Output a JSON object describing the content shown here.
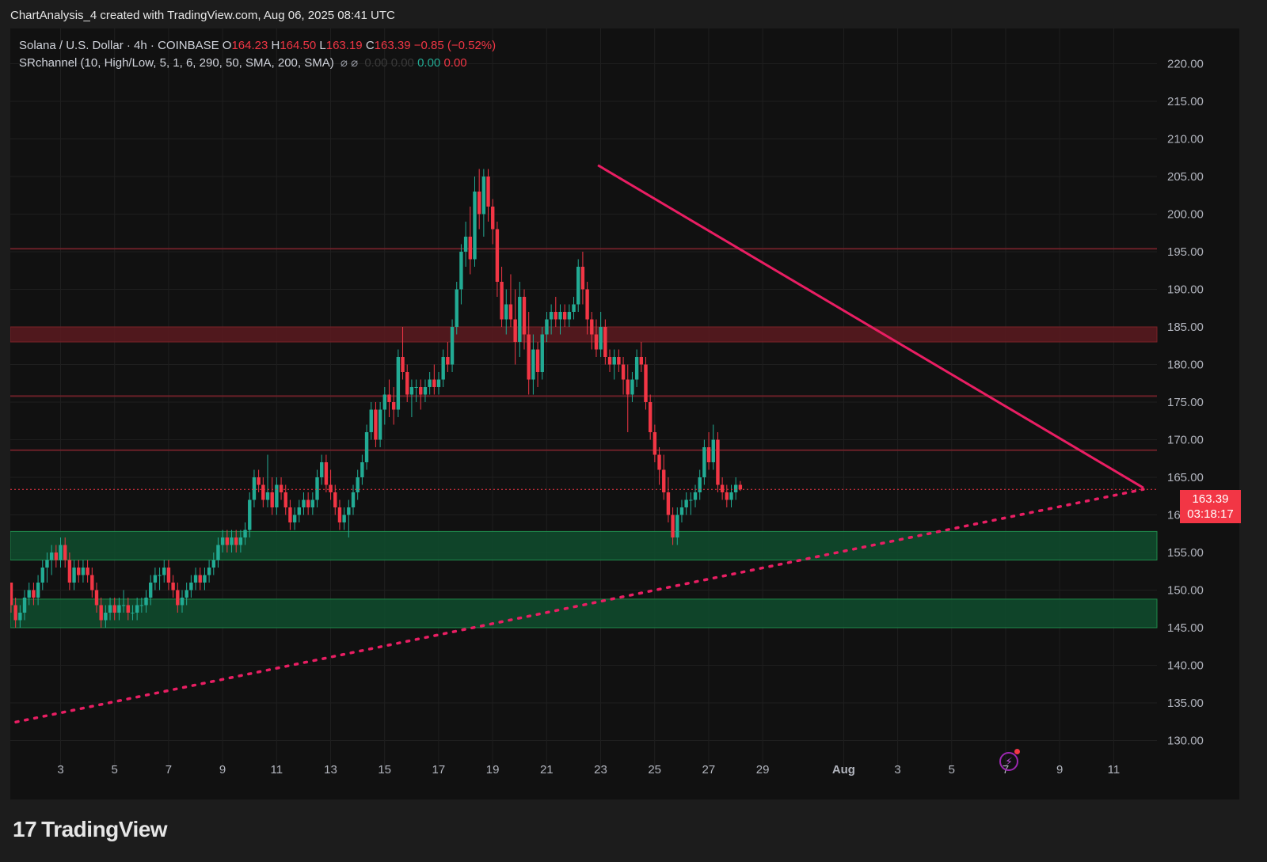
{
  "header": {
    "caption": "ChartAnalysis_4 created with TradingView.com, Aug 06, 2025 08:41 UTC"
  },
  "legend": {
    "symbol": "Solana / U.S. Dollar · 4h · COINBASE",
    "o_label": "O",
    "o_value": "164.23",
    "h_label": "H",
    "h_value": "164.50",
    "l_label": "L",
    "l_value": "163.19",
    "c_label": "C",
    "c_value": "163.39",
    "change": "−0.85 (−0.52%)",
    "indicator": "SRchannel (10, High/Low, 5, 1, 6, 290, 50, SMA, 200, SMA)",
    "indicator_symbols": "⌀ ⌀",
    "ind_v1": "0.00",
    "ind_v2": "0.00",
    "ind_v3": "0.00",
    "ind_v4": "0.00"
  },
  "price_tag": {
    "price": "163.39",
    "countdown": "03:18:17"
  },
  "brand": {
    "logo": "17",
    "name": "TradingView"
  },
  "colors": {
    "background": "#111111",
    "up": "#22ab94",
    "down": "#f23645",
    "trendline": "#e91e63",
    "resistance_zone": "#5c1a20",
    "support_zone": "#0f4a2c",
    "price_tag": "#f23645"
  },
  "chart_data": {
    "type": "candlestick",
    "title": "Solana / U.S. Dollar · 4h · COINBASE",
    "y_axis": {
      "position": "right",
      "ylim": [
        127.5,
        223.5
      ],
      "ticks": [
        "220.00",
        "215.00",
        "210.00",
        "205.00",
        "200.00",
        "195.00",
        "190.00",
        "185.00",
        "180.00",
        "175.00",
        "170.00",
        "165.00",
        "160.00",
        "155.00",
        "150.00",
        "145.00",
        "140.00",
        "135.00",
        "130.00"
      ],
      "tick_values": [
        220,
        215,
        210,
        205,
        200,
        195,
        190,
        185,
        180,
        175,
        170,
        165,
        160,
        155,
        150,
        145,
        140,
        135,
        130
      ]
    },
    "x_axis": {
      "ticks": [
        {
          "label": "3",
          "day": 3
        },
        {
          "label": "5",
          "day": 5
        },
        {
          "label": "7",
          "day": 7
        },
        {
          "label": "9",
          "day": 9
        },
        {
          "label": "11",
          "day": 11
        },
        {
          "label": "13",
          "day": 13
        },
        {
          "label": "15",
          "day": 15
        },
        {
          "label": "17",
          "day": 17
        },
        {
          "label": "19",
          "day": 19
        },
        {
          "label": "21",
          "day": 21
        },
        {
          "label": "23",
          "day": 23
        },
        {
          "label": "25",
          "day": 25
        },
        {
          "label": "27",
          "day": 27
        },
        {
          "label": "29",
          "day": 29
        },
        {
          "label": "Aug",
          "day": 32
        },
        {
          "label": "3",
          "day": 34
        },
        {
          "label": "5",
          "day": 36
        },
        {
          "label": "7",
          "day": 38
        },
        {
          "label": "9",
          "day": 40
        },
        {
          "label": "11",
          "day": 42
        }
      ]
    },
    "grid": true,
    "zones": [
      {
        "kind": "resistance",
        "low": 183,
        "high": 185
      },
      {
        "kind": "support",
        "low": 154,
        "high": 157.8
      },
      {
        "kind": "support",
        "low": 145,
        "high": 148.8
      }
    ],
    "levels": [
      {
        "kind": "resistance",
        "value": 195.4
      },
      {
        "kind": "resistance",
        "value": 175.8
      },
      {
        "kind": "resistance",
        "value": 168.6
      }
    ],
    "trendlines": [
      {
        "kind": "descending",
        "style": "solid",
        "from": {
          "day": 22.9,
          "price": 206.5
        },
        "to": {
          "day": 43.1,
          "price": 163.6
        }
      },
      {
        "kind": "ascending",
        "style": "dotted",
        "from": {
          "day": 1.0,
          "price": 132.2
        },
        "to": {
          "day": 43.1,
          "price": 163.4
        }
      }
    ],
    "last_price": 163.39,
    "ohlc_step_days": 0.1667,
    "candles_start_day": 1.0,
    "candles": [
      [
        153,
        153,
        149,
        151
      ],
      [
        151,
        151,
        147,
        148
      ],
      [
        148,
        149,
        145,
        146
      ],
      [
        146,
        148,
        145,
        147
      ],
      [
        147,
        150,
        146,
        149
      ],
      [
        149,
        151,
        148,
        150
      ],
      [
        150,
        151,
        148,
        149
      ],
      [
        149,
        152,
        148,
        151
      ],
      [
        151,
        154,
        150,
        153
      ],
      [
        153,
        155,
        151,
        154
      ],
      [
        154,
        156,
        152,
        155
      ],
      [
        155,
        156,
        153,
        154
      ],
      [
        154,
        157,
        153,
        156
      ],
      [
        156,
        157,
        153,
        154
      ],
      [
        154,
        155,
        150,
        151
      ],
      [
        151,
        154,
        150,
        153
      ],
      [
        153,
        154,
        151,
        152
      ],
      [
        152,
        154,
        151,
        153
      ],
      [
        153,
        154,
        151,
        152
      ],
      [
        152,
        153,
        149,
        150
      ],
      [
        150,
        151,
        147,
        148
      ],
      [
        148,
        149,
        145,
        146
      ],
      [
        146,
        148,
        145,
        147
      ],
      [
        147,
        149,
        146,
        148
      ],
      [
        148,
        149,
        146,
        147
      ],
      [
        147,
        149,
        146,
        148
      ],
      [
        148,
        150,
        147,
        148
      ],
      [
        148,
        149,
        146,
        147
      ],
      [
        147,
        148,
        146,
        147
      ],
      [
        147,
        149,
        146,
        148
      ],
      [
        148,
        149,
        147,
        148
      ],
      [
        148,
        150,
        147,
        149
      ],
      [
        149,
        152,
        148,
        151
      ],
      [
        151,
        153,
        150,
        152
      ],
      [
        152,
        153,
        150,
        152
      ],
      [
        152,
        154,
        151,
        153
      ],
      [
        153,
        154,
        150,
        151
      ],
      [
        151,
        152,
        149,
        150
      ],
      [
        150,
        151,
        147,
        148
      ],
      [
        148,
        150,
        147,
        149
      ],
      [
        149,
        151,
        148,
        150
      ],
      [
        150,
        152,
        149,
        151
      ],
      [
        151,
        153,
        150,
        152
      ],
      [
        152,
        153,
        150,
        151
      ],
      [
        151,
        153,
        150,
        152
      ],
      [
        152,
        154,
        151,
        153
      ],
      [
        153,
        155,
        152,
        154
      ],
      [
        154,
        157,
        153,
        156
      ],
      [
        156,
        158,
        155,
        157
      ],
      [
        157,
        158,
        155,
        156
      ],
      [
        156,
        158,
        155,
        157
      ],
      [
        157,
        158,
        155,
        156
      ],
      [
        156,
        158,
        155,
        157
      ],
      [
        157,
        159,
        156,
        158
      ],
      [
        158,
        163,
        157,
        162
      ],
      [
        162,
        166,
        161,
        165
      ],
      [
        165,
        166,
        163,
        164
      ],
      [
        164,
        165,
        161,
        162
      ],
      [
        162,
        168,
        161,
        163
      ],
      [
        163,
        165,
        160,
        161
      ],
      [
        161,
        165,
        160,
        164
      ],
      [
        164,
        165,
        162,
        163
      ],
      [
        163,
        164,
        160,
        161
      ],
      [
        161,
        162,
        158,
        159
      ],
      [
        159,
        161,
        158,
        160
      ],
      [
        160,
        162,
        159,
        161
      ],
      [
        161,
        163,
        160,
        162
      ],
      [
        162,
        163,
        160,
        161
      ],
      [
        161,
        163,
        160,
        162
      ],
      [
        162,
        166,
        161,
        165
      ],
      [
        165,
        168,
        164,
        167
      ],
      [
        167,
        168,
        163,
        164
      ],
      [
        164,
        166,
        162,
        163
      ],
      [
        163,
        164,
        160,
        161
      ],
      [
        161,
        162,
        158,
        159
      ],
      [
        159,
        161,
        158,
        160
      ],
      [
        160,
        162,
        157,
        161
      ],
      [
        161,
        164,
        160,
        163
      ],
      [
        163,
        166,
        162,
        165
      ],
      [
        165,
        168,
        164,
        167
      ],
      [
        167,
        172,
        166,
        171
      ],
      [
        171,
        175,
        170,
        174
      ],
      [
        174,
        175,
        169,
        170
      ],
      [
        170,
        175,
        169,
        174
      ],
      [
        174,
        177,
        172,
        176
      ],
      [
        176,
        178,
        173,
        175
      ],
      [
        175,
        177,
        172,
        174
      ],
      [
        174,
        182,
        173,
        181
      ],
      [
        181,
        185,
        178,
        179
      ],
      [
        179,
        180,
        175,
        176
      ],
      [
        176,
        178,
        173,
        177
      ],
      [
        177,
        178,
        175,
        177
      ],
      [
        177,
        178,
        174,
        176
      ],
      [
        176,
        178,
        175,
        177
      ],
      [
        177,
        179,
        176,
        178
      ],
      [
        178,
        180,
        176,
        177
      ],
      [
        177,
        179,
        176,
        178
      ],
      [
        178,
        182,
        177,
        181
      ],
      [
        181,
        183,
        179,
        180
      ],
      [
        180,
        186,
        179,
        185
      ],
      [
        185,
        191,
        184,
        190
      ],
      [
        190,
        196,
        188,
        195
      ],
      [
        195,
        199,
        193,
        197
      ],
      [
        197,
        201,
        192,
        194
      ],
      [
        194,
        205,
        193,
        203
      ],
      [
        203,
        206,
        198,
        200
      ],
      [
        200,
        206,
        197,
        205
      ],
      [
        205,
        206,
        199,
        201
      ],
      [
        201,
        202,
        196,
        198
      ],
      [
        198,
        199,
        189,
        191
      ],
      [
        191,
        193,
        185,
        186
      ],
      [
        186,
        190,
        184,
        188
      ],
      [
        188,
        192,
        185,
        186
      ],
      [
        186,
        190,
        180,
        183
      ],
      [
        183,
        191,
        181,
        189
      ],
      [
        189,
        190,
        182,
        184
      ],
      [
        184,
        187,
        176,
        178
      ],
      [
        178,
        184,
        176,
        182
      ],
      [
        182,
        183,
        177,
        179
      ],
      [
        179,
        185,
        178,
        184
      ],
      [
        184,
        187,
        183,
        186
      ],
      [
        186,
        188,
        184,
        187
      ],
      [
        187,
        189,
        185,
        186
      ],
      [
        186,
        188,
        184,
        187
      ],
      [
        187,
        188,
        185,
        186
      ],
      [
        186,
        188,
        185,
        187
      ],
      [
        187,
        189,
        186,
        188
      ],
      [
        188,
        194,
        187,
        193
      ],
      [
        193,
        195,
        188,
        190
      ],
      [
        190,
        191,
        184,
        186
      ],
      [
        186,
        187,
        182,
        184
      ],
      [
        184,
        186,
        181,
        182
      ],
      [
        182,
        187,
        181,
        185
      ],
      [
        185,
        186,
        180,
        181
      ],
      [
        181,
        182,
        179,
        180
      ],
      [
        180,
        182,
        178,
        181
      ],
      [
        181,
        182,
        179,
        180
      ],
      [
        180,
        181,
        176,
        178
      ],
      [
        178,
        180,
        171,
        176
      ],
      [
        176,
        179,
        175,
        178
      ],
      [
        178,
        182,
        177,
        181
      ],
      [
        181,
        183,
        179,
        180
      ],
      [
        180,
        181,
        174,
        175
      ],
      [
        175,
        176,
        170,
        171
      ],
      [
        171,
        172,
        167,
        168
      ],
      [
        168,
        169,
        164,
        166
      ],
      [
        166,
        168,
        162,
        163
      ],
      [
        163,
        165,
        159,
        160
      ],
      [
        160,
        161,
        156,
        157
      ],
      [
        157,
        161,
        156,
        160
      ],
      [
        160,
        162,
        159,
        161
      ],
      [
        161,
        163,
        160,
        162
      ],
      [
        162,
        163,
        160,
        162
      ],
      [
        162,
        164,
        161,
        163
      ],
      [
        163,
        166,
        162,
        165
      ],
      [
        165,
        170,
        164,
        169
      ],
      [
        169,
        171,
        166,
        167
      ],
      [
        167,
        172,
        166,
        170
      ],
      [
        170,
        171,
        163,
        164
      ],
      [
        164,
        165,
        162,
        163
      ],
      [
        163,
        164,
        161,
        162
      ],
      [
        162,
        164,
        161,
        163
      ],
      [
        163,
        165,
        162,
        164
      ],
      [
        164,
        164.5,
        163.19,
        163.39
      ]
    ]
  }
}
